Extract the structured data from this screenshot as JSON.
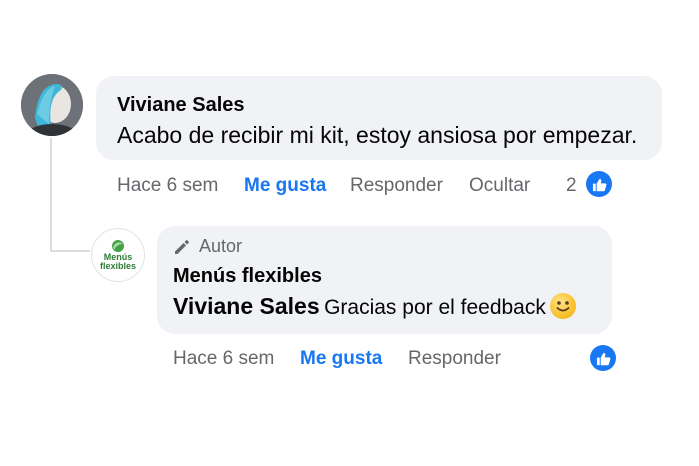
{
  "comment": {
    "author": "Viviane Sales",
    "text": "Acabo de recibir mi kit, estoy ansiosa por empezar.",
    "time": "Hace 6 sem",
    "like_label": "Me gusta",
    "reply_label": "Responder",
    "hide_label": "Ocultar",
    "like_count": "2"
  },
  "reply": {
    "badge_label": "Autor",
    "author": "Menús flexibles",
    "avatar_text": "Menús\nflexibles",
    "mention": "Viviane Sales",
    "text": "Gracias por el feedback",
    "emoji": "slightly-smiling-face",
    "time": "Hace 6 sem",
    "like_label": "Me gusta",
    "reply_label": "Responder"
  },
  "colors": {
    "accent": "#1877f2",
    "bubble": "#f0f2f5",
    "meta_text": "#65676b",
    "brand": "#2e7d32"
  },
  "icons": [
    "like-thumb-icon",
    "pencil-icon"
  ]
}
